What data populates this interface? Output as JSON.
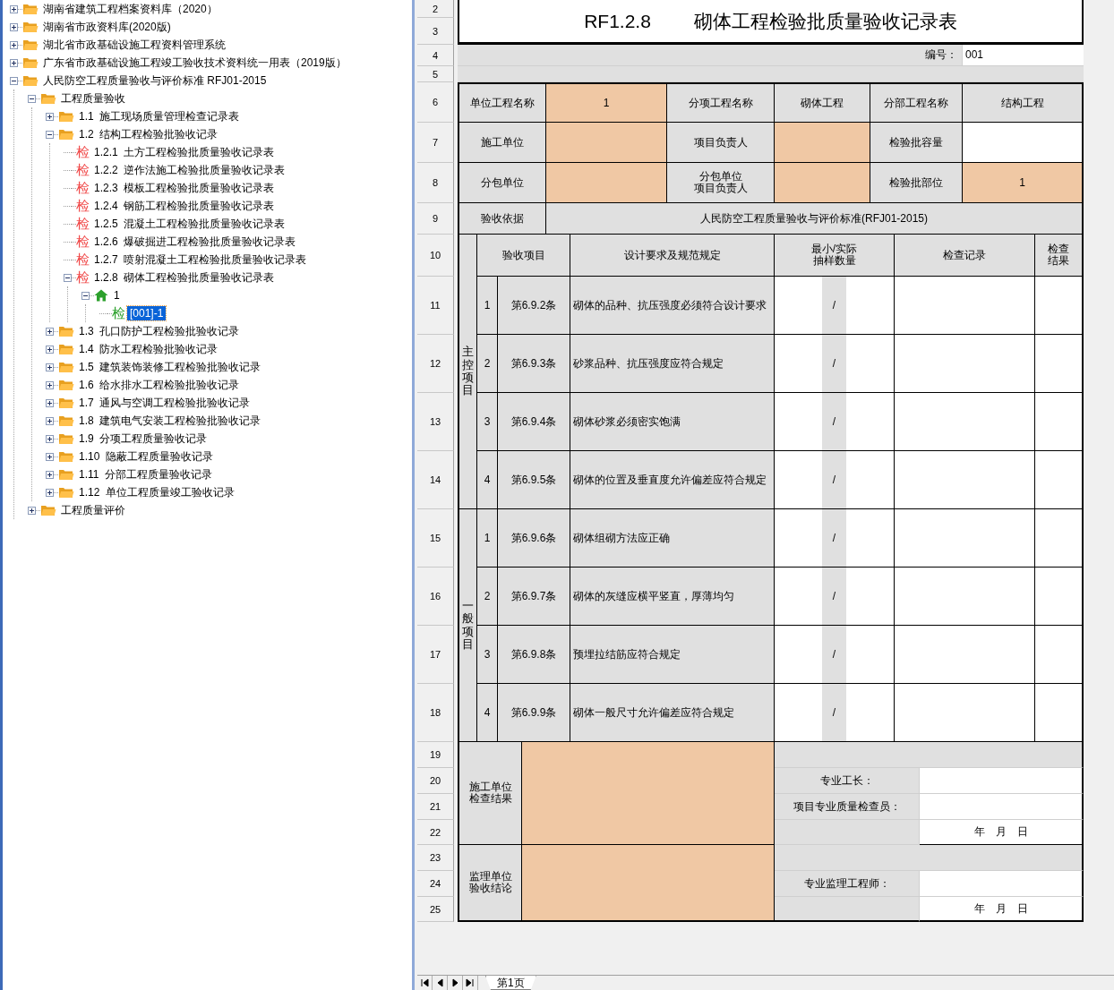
{
  "tree": [
    {
      "label": "湖南省建筑工程档案资料库（2020）",
      "kind": "folder",
      "expanded": false,
      "selected": false
    },
    {
      "label": "湖南省市政资料库(2020版)",
      "kind": "folder",
      "expanded": false,
      "selected": false
    },
    {
      "label": "湖北省市政基础设施工程资料管理系统",
      "kind": "folder",
      "expanded": false,
      "selected": false
    },
    {
      "label": "广东省市政基础设施工程竣工验收技术资料统一用表（2019版）",
      "kind": "folder",
      "expanded": false,
      "selected": false
    },
    {
      "label": "人民防空工程质量验收与评价标准 RFJ01-2015",
      "kind": "folder",
      "expanded": true,
      "selected": false,
      "children": [
        {
          "label": "工程质量验收",
          "kind": "folder",
          "expanded": true,
          "selected": false,
          "children": [
            {
              "label": "1.1  施工现场质量管理检查记录表",
              "kind": "folder",
              "expanded": false,
              "selected": false
            },
            {
              "label": "1.2  结构工程检验批验收记录",
              "kind": "folder",
              "expanded": true,
              "selected": false,
              "children": [
                {
                  "label": "1.2.1  土方工程检验批质量验收记录表",
                  "kind": "template",
                  "icon_text": "检",
                  "selected": false
                },
                {
                  "label": "1.2.2  逆作法施工检验批质量验收记录表",
                  "kind": "template",
                  "icon_text": "检",
                  "selected": false
                },
                {
                  "label": "1.2.3  模板工程检验批质量验收记录表",
                  "kind": "template",
                  "icon_text": "检",
                  "selected": false
                },
                {
                  "label": "1.2.4  钢筋工程检验批质量验收记录表",
                  "kind": "template",
                  "icon_text": "检",
                  "selected": false
                },
                {
                  "label": "1.2.5  混凝土工程检验批质量验收记录表",
                  "kind": "template",
                  "icon_text": "检",
                  "selected": false
                },
                {
                  "label": "1.2.6  爆破掘进工程检验批质量验收记录表",
                  "kind": "template",
                  "icon_text": "检",
                  "selected": false
                },
                {
                  "label": "1.2.7  喷射混凝土工程检验批质量验收记录表",
                  "kind": "template",
                  "icon_text": "检",
                  "selected": false
                },
                {
                  "label": "1.2.8  砌体工程检验批质量验收记录表",
                  "kind": "template",
                  "icon_text": "检",
                  "expanded": true,
                  "selected": false,
                  "children": [
                    {
                      "label": "1",
                      "kind": "group",
                      "expanded": true,
                      "selected": false,
                      "children": [
                        {
                          "label": "[001]-1",
                          "kind": "record",
                          "icon_text": "检",
                          "selected": true
                        }
                      ]
                    }
                  ]
                }
              ]
            },
            {
              "label": "1.3  孔口防护工程检验批验收记录",
              "kind": "folder",
              "expanded": false,
              "selected": false
            },
            {
              "label": "1.4  防水工程检验批验收记录",
              "kind": "folder",
              "expanded": false,
              "selected": false
            },
            {
              "label": "1.5  建筑装饰装修工程检验批验收记录",
              "kind": "folder",
              "expanded": false,
              "selected": false
            },
            {
              "label": "1.6  给水排水工程检验批验收记录",
              "kind": "folder",
              "expanded": false,
              "selected": false
            },
            {
              "label": "1.7  通风与空调工程检验批验收记录",
              "kind": "folder",
              "expanded": false,
              "selected": false
            },
            {
              "label": "1.8  建筑电气安装工程检验批验收记录",
              "kind": "folder",
              "expanded": false,
              "selected": false
            },
            {
              "label": "1.9  分项工程质量验收记录",
              "kind": "folder",
              "expanded": false,
              "selected": false
            },
            {
              "label": "1.10  隐蔽工程质量验收记录",
              "kind": "folder",
              "expanded": false,
              "selected": false
            },
            {
              "label": "1.11  分部工程质量验收记录",
              "kind": "folder",
              "expanded": false,
              "selected": false
            },
            {
              "label": "1.12  单位工程质量竣工验收记录",
              "kind": "folder",
              "expanded": false,
              "selected": false
            }
          ]
        },
        {
          "label": "工程质量评价",
          "kind": "folder",
          "expanded": false,
          "selected": false
        }
      ]
    }
  ],
  "sheet": {
    "row_numbers": [
      "2",
      "3",
      "4",
      "5",
      "6",
      "7",
      "8",
      "9",
      "10",
      "11",
      "12",
      "13",
      "14",
      "15",
      "16",
      "17",
      "18",
      "19",
      "20",
      "21",
      "22",
      "23",
      "24",
      "25"
    ],
    "code": "RF1.2.8",
    "title": "砌体工程检验批质量验收记录表",
    "serial_label": "编号：",
    "serial": "001",
    "info_rows": [
      [
        {
          "label": [
            "单位工程名称"
          ],
          "value": "1",
          "kind": "required"
        },
        {
          "label": [
            "分项工程名称"
          ],
          "value": "砌体工程",
          "kind": "fixed"
        },
        {
          "label": [
            "分部工程名称"
          ],
          "value": "结构工程",
          "kind": "fixed"
        }
      ],
      [
        {
          "label": [
            "施工单位"
          ],
          "kind": "required"
        },
        {
          "label": [
            "项目负责人"
          ],
          "kind": "required"
        },
        {
          "label": [
            "检验批容量"
          ],
          "kind": "optional"
        }
      ],
      [
        {
          "label": [
            "分包单位"
          ],
          "kind": "required"
        },
        {
          "label": [
            "分包单位",
            "项目负责人"
          ],
          "kind": "required"
        },
        {
          "label": [
            "检验批部位"
          ],
          "value": "1",
          "kind": "required"
        }
      ]
    ],
    "basis": {
      "label": "验收依据",
      "value": "人民防空工程质量验收与评价标准(RFJ01-2015)"
    },
    "headers": [
      [
        "验收项目"
      ],
      [
        "设计要求及规范规定"
      ],
      [
        "最小/实际",
        "抽样数量"
      ],
      [
        "检查记录"
      ],
      [
        "检查",
        "结果"
      ]
    ],
    "groups": [
      {
        "label": "主控项目",
        "items": [
          {
            "no": "1",
            "clause": "第6.9.2条",
            "requirement": "砌体的品种、抗压强度必须符合设计要求",
            "sample": "/"
          },
          {
            "no": "2",
            "clause": "第6.9.3条",
            "requirement": "砂浆品种、抗压强度应符合规定",
            "sample": "/"
          },
          {
            "no": "3",
            "clause": "第6.9.4条",
            "requirement": "砌体砂浆必须密实饱满",
            "sample": "/"
          },
          {
            "no": "4",
            "clause": "第6.9.5条",
            "requirement": "砌体的位置及垂直度允许偏差应符合规定",
            "sample": "/"
          }
        ]
      },
      {
        "label": "一般项目",
        "items": [
          {
            "no": "1",
            "clause": "第6.9.6条",
            "requirement": "砌体组砌方法应正确",
            "sample": "/"
          },
          {
            "no": "2",
            "clause": "第6.9.7条",
            "requirement": "砌体的灰缝应横平竖直，厚薄均匀",
            "sample": "/"
          },
          {
            "no": "3",
            "clause": "第6.9.8条",
            "requirement": "预埋拉结筋应符合规定",
            "sample": "/"
          },
          {
            "no": "4",
            "clause": "第6.9.9条",
            "requirement": "砌体一般尺寸允许偏差应符合规定",
            "sample": "/"
          }
        ]
      }
    ],
    "sign_sections": [
      {
        "label": [
          "施工单位",
          "检查结果"
        ],
        "signers": [
          "专业工长：",
          "项目专业质量检查员："
        ],
        "date": "年　月　日"
      },
      {
        "label": [
          "监理单位",
          "验收结论"
        ],
        "signers": [
          "专业监理工程师："
        ],
        "date": "年　月　日"
      }
    ]
  },
  "sheet_tabs": [
    {
      "label": "第1页",
      "selected": true
    }
  ]
}
